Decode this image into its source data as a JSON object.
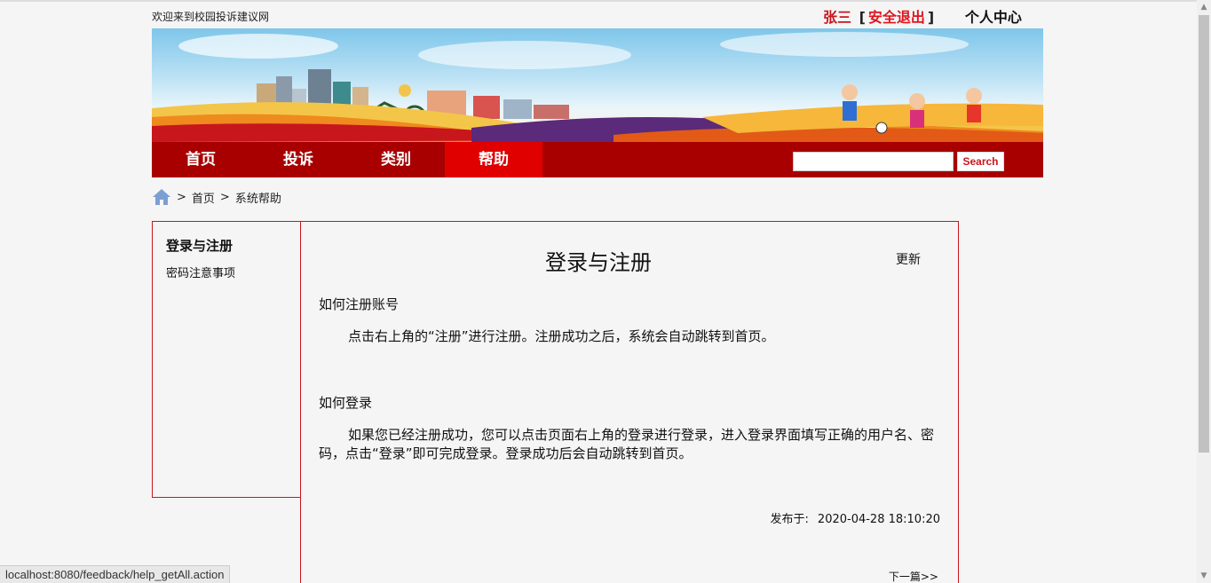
{
  "header": {
    "welcome": "欢迎来到校园投诉建议网",
    "user_name": "张三",
    "bracket_open": "[",
    "logout": "安全退出",
    "bracket_close": "]",
    "user_center": "个人中心"
  },
  "nav": {
    "items": [
      {
        "label": "首页"
      },
      {
        "label": "投诉"
      },
      {
        "label": "类别"
      },
      {
        "label": "帮助"
      }
    ],
    "active_index": 3,
    "search_value": "",
    "search_button": "Search"
  },
  "breadcrumb": {
    "sep": ">",
    "home": "首页",
    "current": "系统帮助"
  },
  "sidebar": {
    "title": "登录与注册",
    "links": [
      "密码注意事项"
    ]
  },
  "article": {
    "title": "登录与注册",
    "update_label": "更新",
    "sections": [
      {
        "question": "如何注册账号",
        "answer": "点击右上角的“注册”进行注册。注册成功之后，系统会自动跳转到首页。"
      },
      {
        "question": "如何登录",
        "answer": "如果您已经注册成功，您可以点击页面右上角的登录进行登录，进入登录界面填写正确的用户名、密码，点击“登录”即可完成登录。登录成功后会自动跳转到首页。"
      }
    ],
    "published_label": "发布于:",
    "published_time": "2020-04-28 18:10:20",
    "next_label": "下一篇>>"
  },
  "status_bar": {
    "url": "localhost:8080/feedback/help_getAll.action"
  },
  "colors": {
    "nav_bg": "#a80000",
    "nav_active": "#e00000",
    "accent_red": "#c8161d"
  }
}
